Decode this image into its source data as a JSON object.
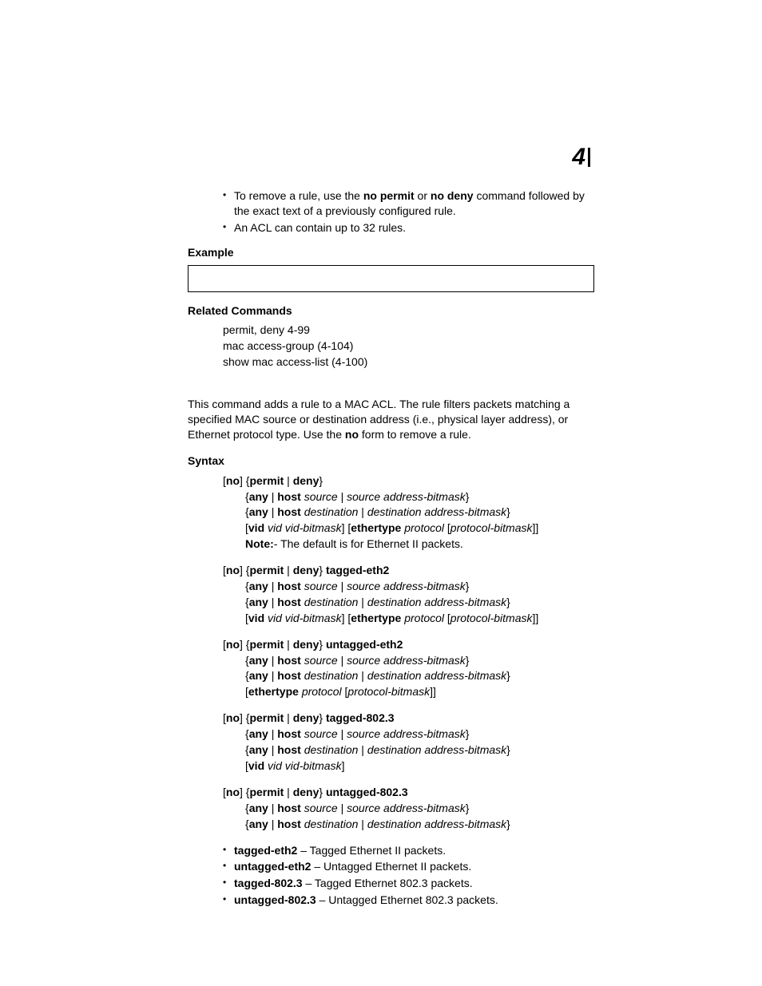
{
  "chapter_number": "4",
  "intro_bullets": {
    "b1_pre": "To remove a rule, use the ",
    "b1_bold1": "no permit",
    "b1_mid": " or ",
    "b1_bold2": "no deny",
    "b1_post": " command followed by the exact text of a previously configured rule.",
    "b2": "An ACL can contain up to 32 rules."
  },
  "headings": {
    "example": "Example",
    "related": "Related Commands",
    "syntax": "Syntax"
  },
  "related": {
    "r1": "permit, deny 4-99",
    "r2": "mac access-group (4-104)",
    "r3": "show mac access-list (4-100)"
  },
  "body_para": {
    "p1": "This command adds a rule to a MAC ACL. The rule filters packets matching a specified MAC source or destination address (i.e., physical layer address), or Ethernet protocol type. Use the ",
    "p1_bold": "no",
    "p1_post": " form to remove a rule."
  },
  "tok": {
    "lbr": "[",
    "rbr": "]",
    "lcb": "{",
    "rcb": "}",
    "pipe": " | ",
    "no": "no",
    "permit": "permit",
    "deny": "deny",
    "any": "any",
    "host": "host",
    "vid": "vid",
    "ethertype": "ethertype",
    "source": "source",
    "source_ab": "source address-bitmask",
    "dest": "destination",
    "dest_ab": "destination address-bitmask",
    "vid_vb": "vid vid-bitmask",
    "protocol": "protocol",
    "protocol_bm": "protocol-bitmask",
    "tagged_eth2": " tagged-eth2",
    "untagged_eth2": " untagged-eth2",
    "tagged_8023": " tagged-802.3",
    "untagged_8023": " untagged-802.3"
  },
  "note": {
    "bold": "Note:",
    "text": "- The default is for Ethernet II packets."
  },
  "defs": {
    "d1b": "tagged-eth2",
    "d1t": " – Tagged Ethernet II packets.",
    "d2b": "untagged-eth2",
    "d2t": " – Untagged Ethernet II packets.",
    "d3b": "tagged-802.3",
    "d3t": " – Tagged Ethernet 802.3 packets.",
    "d4b": "untagged-802.3",
    "d4t": " – Untagged Ethernet 802.3 packets."
  }
}
